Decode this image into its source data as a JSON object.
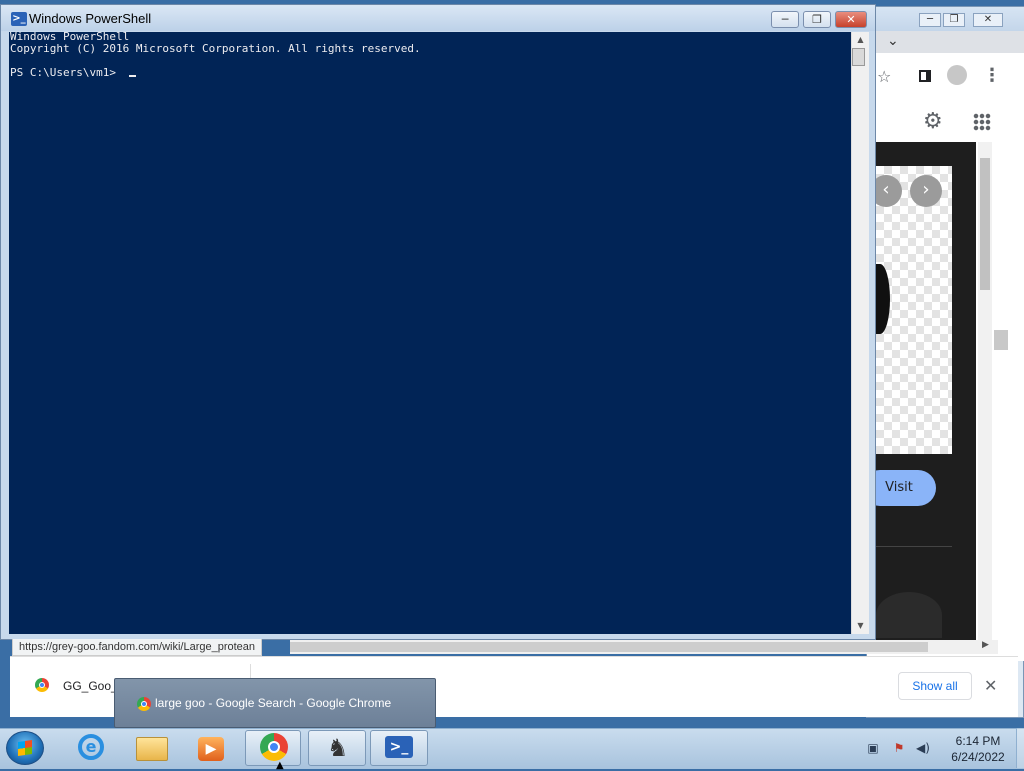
{
  "powershell": {
    "title": "Windows PowerShell",
    "lines": [
      "Windows PowerShell",
      "Copyright (C) 2016 Microsoft Corporation. All rights reserved.",
      "",
      "PS C:\\Users\\vm1> "
    ],
    "background_color": "#012456",
    "text_color": "#eeedf0"
  },
  "chrome": {
    "visit_label": "Visit",
    "status_url": "https://grey-goo.fandom.com/wiki/Large_protean",
    "download": {
      "filename": "GG_Goo_",
      "show_all_label": "Show all",
      "close_label": "✕"
    }
  },
  "taskbar": {
    "thumbnail_tooltip": "large goo - Google Search - Google Chrome",
    "clock_time": "6:14 PM",
    "clock_date": "6/24/2022"
  },
  "icons": {
    "minimize": "─",
    "maximize": "❐",
    "close": "✕",
    "prev": "‹",
    "next": "›",
    "chevron_down": "⌄",
    "star": "☆",
    "gear": "⚙",
    "apps": "⋮⋮⋮",
    "kebab": "⋮"
  }
}
